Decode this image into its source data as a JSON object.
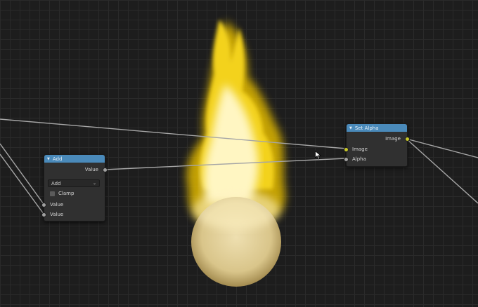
{
  "add_node": {
    "title": "Add",
    "output_value": "Value",
    "operation": "Add",
    "clamp_label": "Clamp",
    "input_1": "Value",
    "input_2": "Value"
  },
  "set_alpha_node": {
    "title": "Set Alpha",
    "output_image": "Image",
    "input_image": "Image",
    "input_alpha": "Alpha"
  },
  "colors": {
    "header": "#4a8aba",
    "float_socket": "#a0a0a0",
    "color_socket": "#c7c729",
    "background": "#1d1d1d"
  }
}
